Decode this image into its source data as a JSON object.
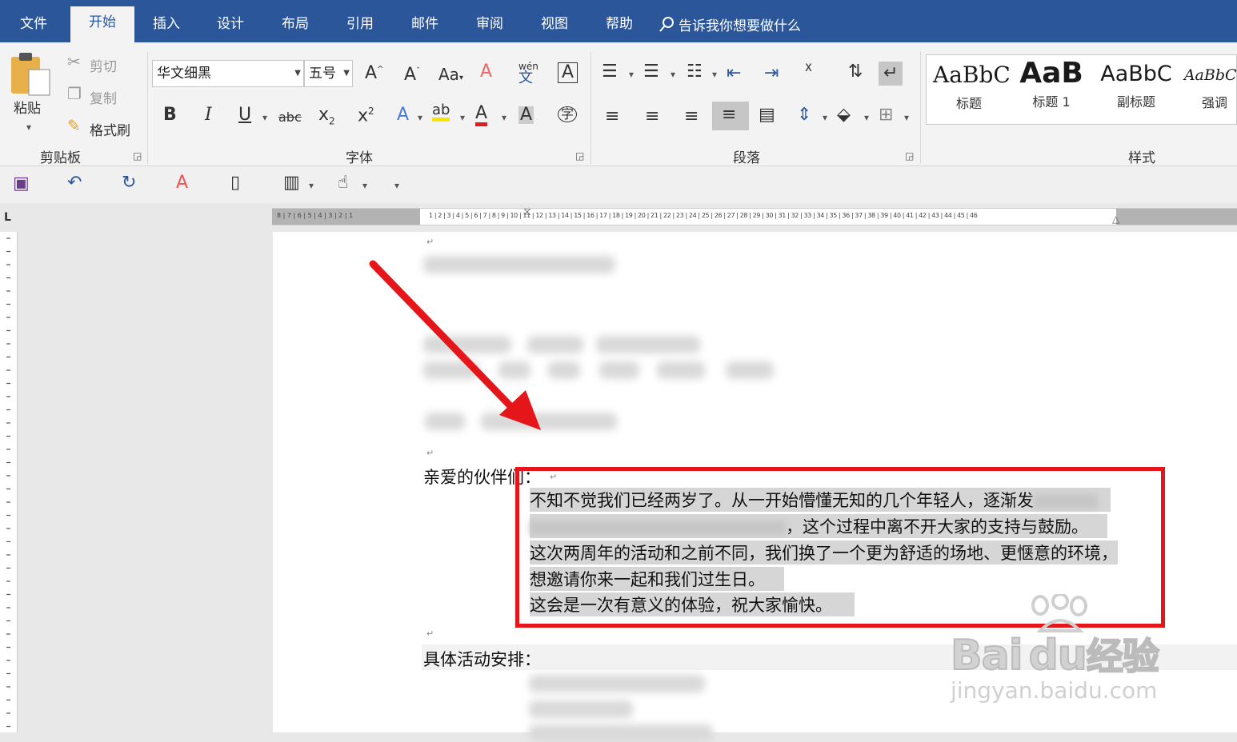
{
  "tabs": [
    {
      "label": "文件"
    },
    {
      "label": "开始"
    },
    {
      "label": "插入"
    },
    {
      "label": "设计"
    },
    {
      "label": "布局"
    },
    {
      "label": "引用"
    },
    {
      "label": "邮件"
    },
    {
      "label": "审阅"
    },
    {
      "label": "视图"
    },
    {
      "label": "帮助"
    }
  ],
  "tell_me": "告诉我你想要做什么",
  "clipboard": {
    "paste": "粘贴",
    "cut": "剪切",
    "copy": "复制",
    "format_painter": "格式刷",
    "group": "剪贴板"
  },
  "font": {
    "name": "华文细黑",
    "size": "五号",
    "case": "Aa",
    "phonetic": "wén",
    "group": "字体"
  },
  "paragraph": {
    "group": "段落"
  },
  "styles": {
    "group": "样式",
    "items": [
      {
        "preview": "AaBbC",
        "name": "标题"
      },
      {
        "preview": "AaB",
        "name": "标题 1"
      },
      {
        "preview": "AaBbC",
        "name": "副标题"
      },
      {
        "preview": "AaBbCc",
        "name": "强调"
      }
    ]
  },
  "ruler": {
    "corner": "L",
    "left_numbers": "8 | 7 | 6 | 5 | 4 | 3 | 2 | 1",
    "right_numbers": "1 | 2 | 3 | 4 | 5 | 6 | 7 | 8 | 9 | 10 | 11 | 12 | 13 | 14 | 15 | 16 | 17 | 18 | 19 | 20 | 21 | 22 | 23 | 24 | 25 | 26 | 27 | 28 | 29 | 30 | 31 | 32 | 33 | 34 | 35 | 36 | 37 | 38 | 39 | 40 | 41 | 42 | 43 | 44 | 45 | 46"
  },
  "doc": {
    "greeting": "亲爱的伙伴们：",
    "line1": "不知不觉我们已经两岁了。从一开始懵懂无知的几个年轻人，逐渐发",
    "line2": "，这个过程中离不开大家的支持与鼓励。",
    "line3": "这次两周年的活动和之前不同，我们换了一个更为舒适的场地、更惬意的环境，",
    "line4": "想邀请你来一起和我们过生日。",
    "line5": "这会是一次有意义的体验，祝大家愉快。",
    "schedule": "具体活动安排："
  },
  "watermark": {
    "brand": "Bai",
    "brand2": "du",
    "brand3": "经验",
    "url": "jingyan.baidu.com"
  },
  "colors": {
    "ribbon_blue": "#2b579a",
    "annotation_red": "#e5161a"
  }
}
